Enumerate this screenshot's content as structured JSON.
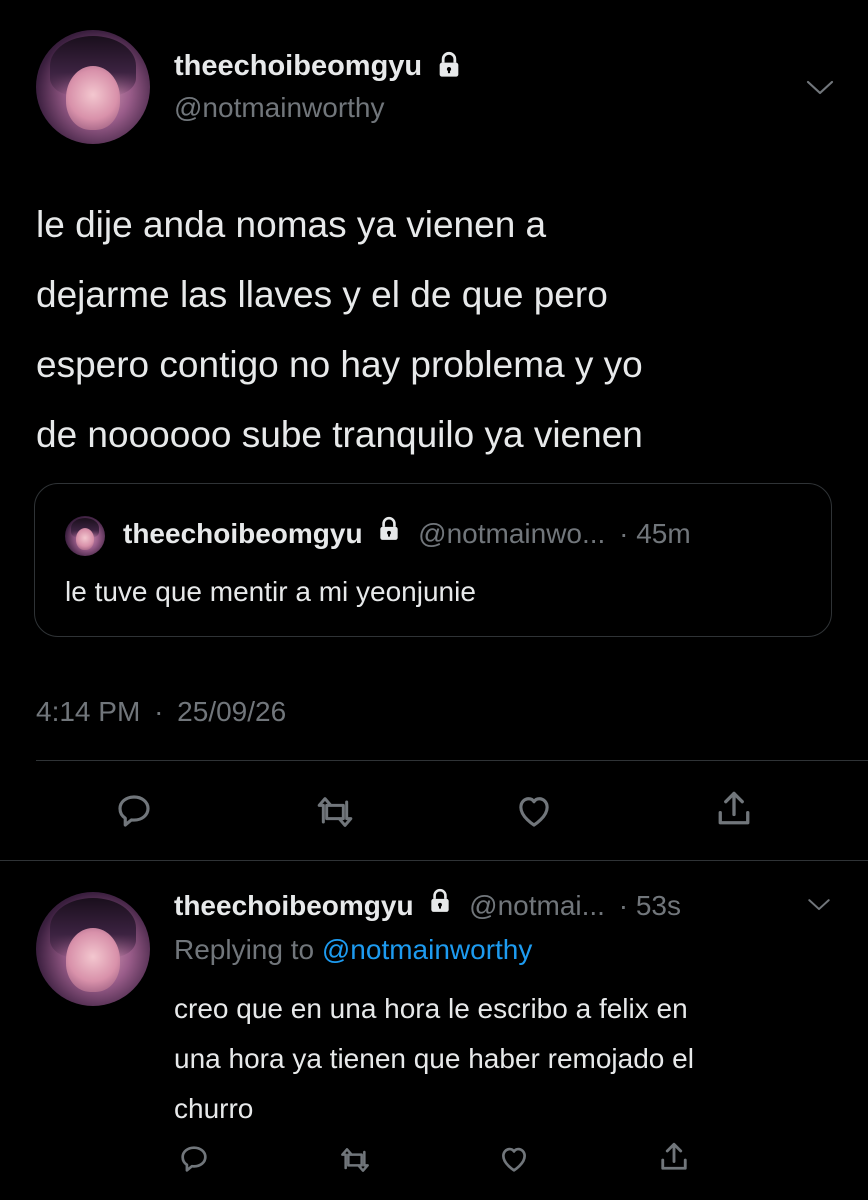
{
  "main_tweet": {
    "display_name": "theechoibeomgyu",
    "handle": "@notmainworthy",
    "text_lines": [
      "le dije anda nomas ya vienen a",
      "dejarme las llaves y el de que pero",
      "espero contigo no hay problema y yo",
      "de noooooo sube tranquilo ya vienen"
    ],
    "time": "4:14 PM",
    "dot": "·",
    "date": "25/09/26"
  },
  "quoted_tweet": {
    "display_name": "theechoibeomgyu",
    "handle": "@notmainwo...",
    "dot_time": "· 45m",
    "text": "le tuve que mentir a mi yeonjunie"
  },
  "reply_tweet": {
    "display_name": "theechoibeomgyu",
    "handle": "@notmai...",
    "dot_time": "· 53s",
    "replying_prefix": "Replying to ",
    "replying_to": "@notmainworthy",
    "text_lines": [
      "creo que en una hora le escribo a felix en",
      "una hora ya tienen que haber remojado el",
      "churro"
    ]
  },
  "icons": {
    "lock": "lock-icon",
    "chevron": "chevron-down-icon",
    "reply": "reply-icon",
    "retweet": "retweet-icon",
    "like": "like-icon",
    "share": "share-icon"
  },
  "colors": {
    "background": "#000000",
    "text": "#e7e9ea",
    "muted": "#71767b",
    "link": "#1d9bf0",
    "divider": "#2f3336"
  }
}
